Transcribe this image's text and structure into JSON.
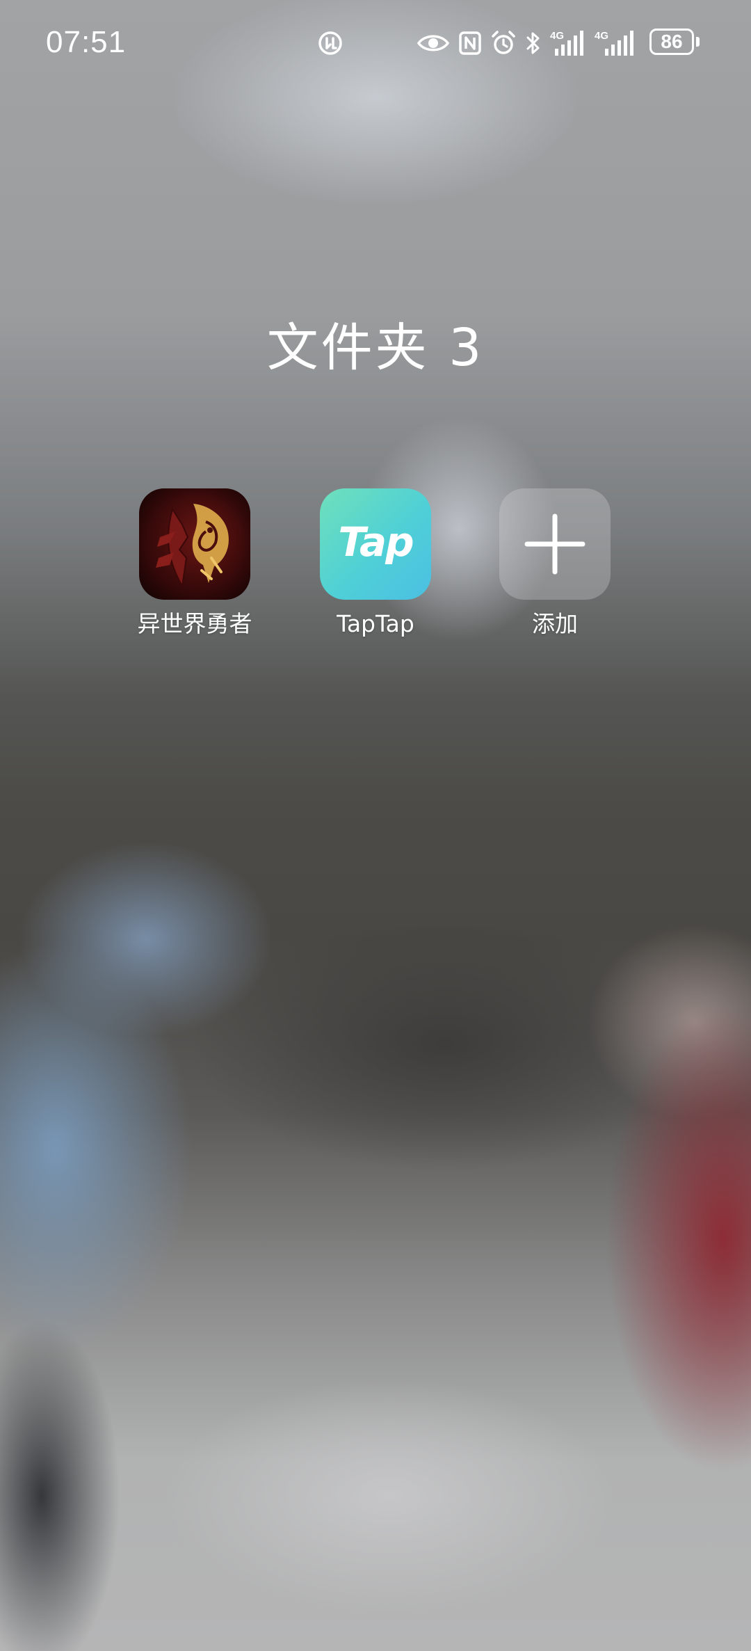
{
  "status_bar": {
    "time": "07:51",
    "battery_level": "86",
    "signal_1_label": "4G",
    "signal_2_label": "4G",
    "icons": [
      "data-saver-icon",
      "eye-comfort-icon",
      "nfc-icon",
      "alarm-icon",
      "bluetooth-icon",
      "signal-4g-icon",
      "signal-4g-icon",
      "battery-icon"
    ]
  },
  "folder": {
    "title": "文件夹 3",
    "apps": [
      {
        "label": "异世界勇者",
        "icon": "horde-emblem-icon"
      },
      {
        "label": "TapTap",
        "icon": "taptap-logo-icon",
        "logo_text": "Tap"
      },
      {
        "label": "添加",
        "icon": "add-icon"
      }
    ]
  },
  "colors": {
    "text": "#ffffff",
    "taptap_gradient_start": "#6fe0bb",
    "taptap_gradient_end": "#4bbfe3",
    "game_icon_red": "#6a1614",
    "game_icon_gold": "#d8a64a"
  }
}
